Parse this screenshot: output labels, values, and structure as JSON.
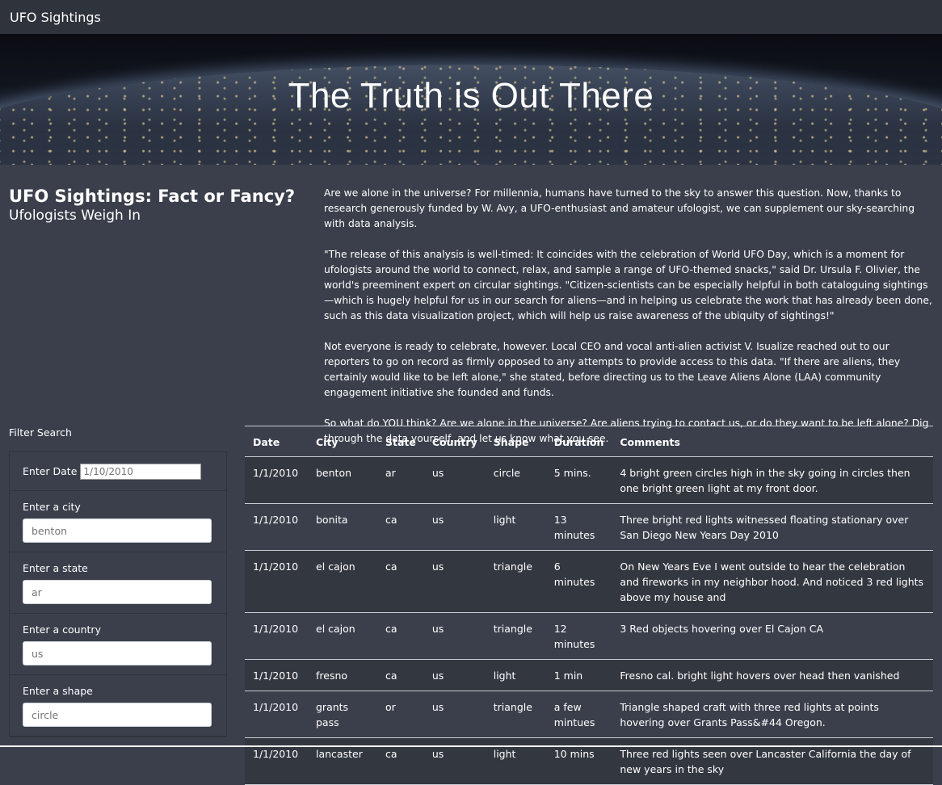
{
  "nav": {
    "brand": "UFO Sightings"
  },
  "hero": {
    "title": "The Truth is Out There"
  },
  "intro": {
    "title": "UFO Sightings: Fact or Fancy?",
    "subtitle": "Ufologists Weigh In",
    "paragraphs": [
      "Are we alone in the universe? For millennia, humans have turned to the sky to answer this question. Now, thanks to research generously funded by W. Avy, a UFO-enthusiast and amateur ufologist, we can supplement our sky-searching with data analysis.",
      "\"The release of this analysis is well-timed: It coincides with the celebration of World UFO Day, which is a moment for ufologists around the world to connect, relax, and sample a range of UFO-themed snacks,\" said Dr. Ursula F. Olivier, the world's preeminent expert on circular sightings. \"Citizen-scientists can be especially helpful in both cataloguing sightings—which is hugely helpful for us in our search for aliens—and in helping us celebrate the work that has already been done, such as this data visualization project, which will help us raise awareness of the ubiquity of sightings!\"",
      "Not everyone is ready to celebrate, however. Local CEO and vocal anti-alien activist V. Isualize reached out to our reporters to go on record as firmly opposed to any attempts to provide access to this data. \"If there are aliens, they certainly would like to be left alone,\" she stated, before directing us to the Leave Aliens Alone (LAA) community engagement initiative she founded and funds.",
      "So what do YOU think? Are we alone in the universe? Are aliens trying to contact us, or do they want to be left alone? Dig through the data yourself, and let us know what you see."
    ]
  },
  "filters": {
    "heading": "Filter Search",
    "date": {
      "label": "Enter Date",
      "placeholder": "1/10/2010"
    },
    "city": {
      "label": "Enter a city",
      "placeholder": "benton"
    },
    "state": {
      "label": "Enter a state",
      "placeholder": "ar"
    },
    "country": {
      "label": "Enter a country",
      "placeholder": "us"
    },
    "shape": {
      "label": "Enter a shape",
      "placeholder": "circle"
    }
  },
  "table": {
    "headers": [
      "Date",
      "City",
      "State",
      "Country",
      "Shape",
      "Duration",
      "Comments"
    ],
    "rows": [
      [
        "1/1/2010",
        "benton",
        "ar",
        "us",
        "circle",
        "5 mins.",
        "4 bright green circles high in the sky going in circles then one bright green light at my front door."
      ],
      [
        "1/1/2010",
        "bonita",
        "ca",
        "us",
        "light",
        "13 minutes",
        "Three bright red lights witnessed floating stationary over San Diego New Years Day 2010"
      ],
      [
        "1/1/2010",
        "el cajon",
        "ca",
        "us",
        "triangle",
        "6 minutes",
        "On New Years Eve I went outside to hear the celebration and fireworks in my neighbor hood. And noticed 3 red lights above my house and"
      ],
      [
        "1/1/2010",
        "el cajon",
        "ca",
        "us",
        "triangle",
        "12 minutes",
        "3 Red objects hovering over El Cajon CA"
      ],
      [
        "1/1/2010",
        "fresno",
        "ca",
        "us",
        "light",
        "1 min",
        "Fresno cal. bright light hovers over head then vanished"
      ],
      [
        "1/1/2010",
        "grants pass",
        "or",
        "us",
        "triangle",
        "a few mintues",
        "Triangle shaped craft with three red lights at points hovering over Grants Pass&#44 Oregon."
      ],
      [
        "1/1/2010",
        "lancaster",
        "ca",
        "us",
        "light",
        "10 mins",
        "Three red lights seen over Lancaster California the day of new years in the sky"
      ]
    ]
  }
}
